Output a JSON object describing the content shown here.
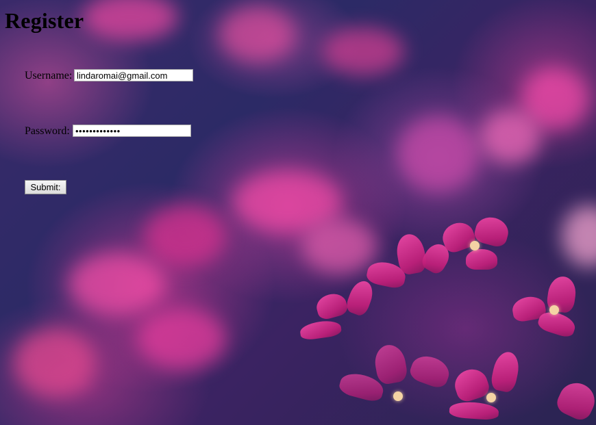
{
  "page": {
    "title": "Register"
  },
  "form": {
    "username_label": "Username:",
    "username_value": "lindaromai@gmail.com",
    "password_label": "Password:",
    "password_value": "•••••••••••••",
    "submit_label": "Submit:"
  },
  "background": {
    "description_colors": [
      "#2a2456",
      "#c21f7a",
      "#f24aa8"
    ]
  }
}
